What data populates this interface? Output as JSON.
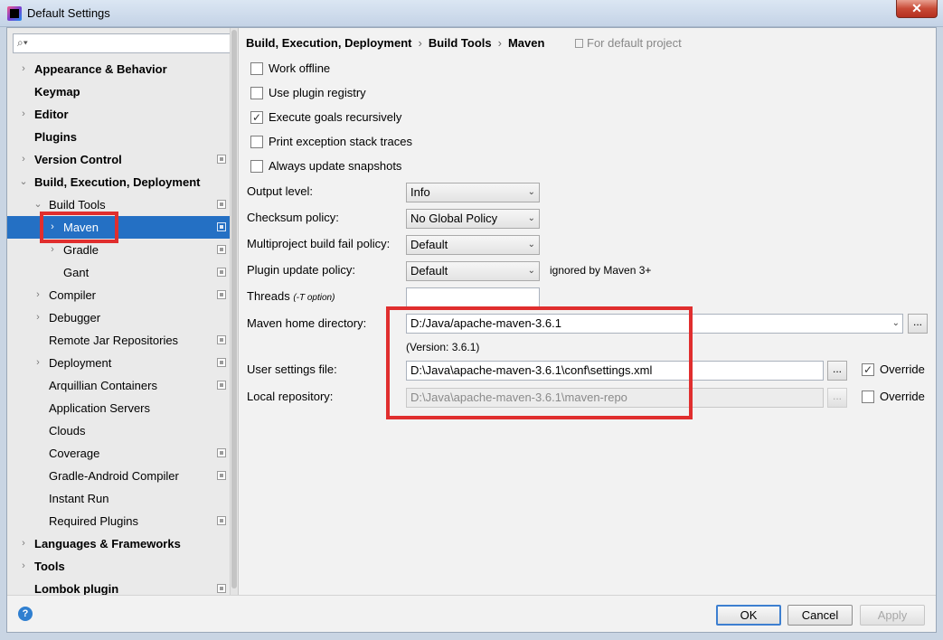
{
  "window": {
    "title": "Default Settings",
    "close_glyph": "✕"
  },
  "sidebar": {
    "search_icon": "⌕▾",
    "items": [
      {
        "label": "Appearance & Behavior",
        "arrow": "›",
        "bold": true,
        "level": 0
      },
      {
        "label": "Keymap",
        "arrow": "",
        "bold": true,
        "level": 0
      },
      {
        "label": "Editor",
        "arrow": "›",
        "bold": true,
        "level": 0
      },
      {
        "label": "Plugins",
        "arrow": "",
        "bold": true,
        "level": 0
      },
      {
        "label": "Version Control",
        "arrow": "›",
        "bold": true,
        "level": 0,
        "icon": true
      },
      {
        "label": "Build, Execution, Deployment",
        "arrow": "⌄",
        "bold": true,
        "level": 0
      },
      {
        "label": "Build Tools",
        "arrow": "⌄",
        "bold": false,
        "level": 1,
        "icon": true
      },
      {
        "label": "Maven",
        "arrow": "›",
        "bold": false,
        "level": 2,
        "icon": true,
        "selected": true
      },
      {
        "label": "Gradle",
        "arrow": "›",
        "bold": false,
        "level": 2,
        "icon": true
      },
      {
        "label": "Gant",
        "arrow": "",
        "bold": false,
        "level": 2,
        "icon": true
      },
      {
        "label": "Compiler",
        "arrow": "›",
        "bold": false,
        "level": 1,
        "icon": true
      },
      {
        "label": "Debugger",
        "arrow": "›",
        "bold": false,
        "level": 1
      },
      {
        "label": "Remote Jar Repositories",
        "arrow": "",
        "bold": false,
        "level": 1,
        "icon": true
      },
      {
        "label": "Deployment",
        "arrow": "›",
        "bold": false,
        "level": 1,
        "icon": true
      },
      {
        "label": "Arquillian Containers",
        "arrow": "",
        "bold": false,
        "level": 1,
        "icon": true
      },
      {
        "label": "Application Servers",
        "arrow": "",
        "bold": false,
        "level": 1
      },
      {
        "label": "Clouds",
        "arrow": "",
        "bold": false,
        "level": 1
      },
      {
        "label": "Coverage",
        "arrow": "",
        "bold": false,
        "level": 1,
        "icon": true
      },
      {
        "label": "Gradle-Android Compiler",
        "arrow": "",
        "bold": false,
        "level": 1,
        "icon": true
      },
      {
        "label": "Instant Run",
        "arrow": "",
        "bold": false,
        "level": 1
      },
      {
        "label": "Required Plugins",
        "arrow": "",
        "bold": false,
        "level": 1,
        "icon": true
      },
      {
        "label": "Languages & Frameworks",
        "arrow": "›",
        "bold": true,
        "level": 0
      },
      {
        "label": "Tools",
        "arrow": "›",
        "bold": true,
        "level": 0
      },
      {
        "label": "Lombok plugin",
        "arrow": "",
        "bold": true,
        "level": 0,
        "icon": true
      }
    ]
  },
  "breadcrumb": {
    "part1": "Build, Execution, Deployment",
    "part2": "Build Tools",
    "part3": "Maven",
    "sep": "›",
    "note": "For default project"
  },
  "checks": {
    "work_offline": {
      "label": "Work offline",
      "checked": false
    },
    "plugin_registry": {
      "label": "Use plugin registry",
      "checked": false
    },
    "execute_goals": {
      "label": "Execute goals recursively",
      "checked": true
    },
    "print_exception": {
      "label": "Print exception stack traces",
      "checked": false
    },
    "update_snapshots": {
      "label": "Always update snapshots",
      "checked": false
    },
    "check_glyph": "✓"
  },
  "fields": {
    "output_level": {
      "label": "Output level:",
      "value": "Info"
    },
    "checksum_policy": {
      "label": "Checksum policy:",
      "value": "No Global Policy"
    },
    "fail_policy": {
      "label": "Multiproject build fail policy:",
      "value": "Default"
    },
    "update_policy": {
      "label": "Plugin update policy:",
      "value": "Default",
      "note": "ignored by Maven 3+"
    },
    "threads": {
      "label": "Threads",
      "hint": "(-T option)",
      "value": ""
    },
    "maven_home": {
      "label": "Maven home directory:",
      "value": "D:/Java/apache-maven-3.6.1",
      "version": "(Version: 3.6.1)"
    },
    "user_settings": {
      "label": "User settings file:",
      "value": "D:\\Java\\apache-maven-3.6.1\\conf\\settings.xml",
      "override_label": "Override",
      "override_checked": true
    },
    "local_repo": {
      "label": "Local repository:",
      "value": "D:\\Java\\apache-maven-3.6.1\\maven-repo",
      "override_label": "Override",
      "override_checked": false
    },
    "browse_label": "...",
    "chevron": "⌄"
  },
  "buttons": {
    "help": "?",
    "ok": "OK",
    "cancel": "Cancel",
    "apply": "Apply"
  },
  "colors": {
    "selection": "#2470c4",
    "highlight_box": "#e02e2e",
    "default_button_border": "#3d7fd0"
  }
}
